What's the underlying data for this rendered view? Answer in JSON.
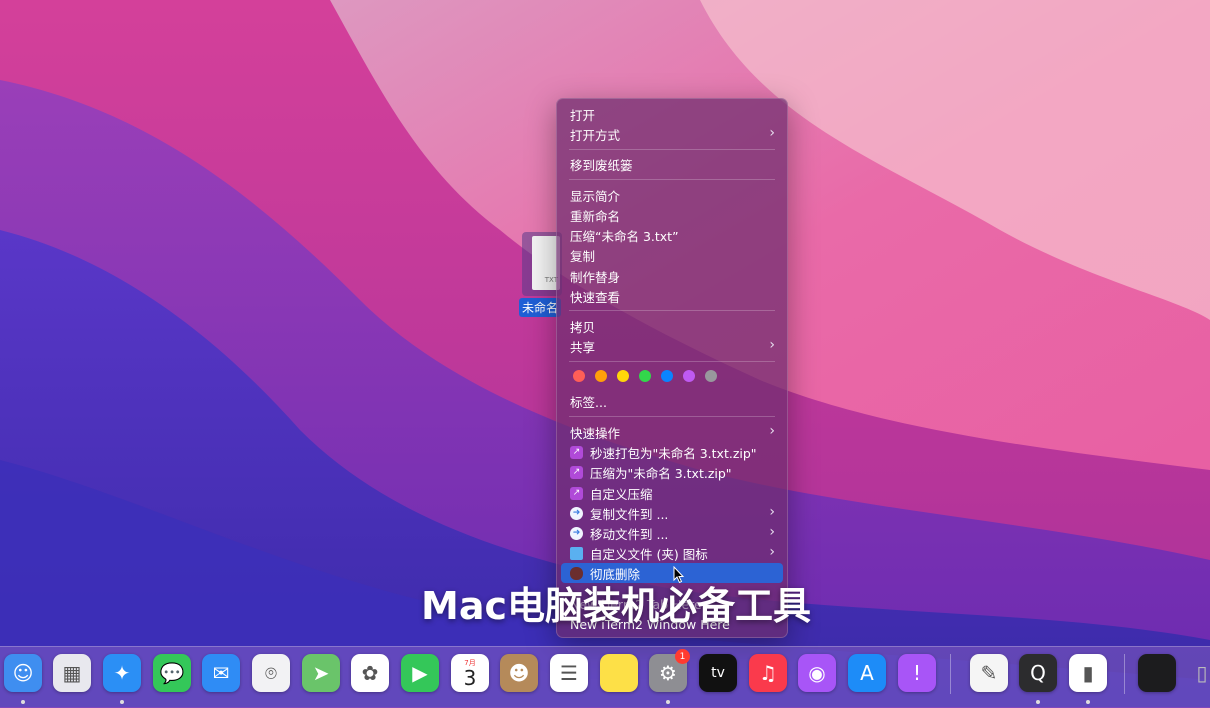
{
  "file": {
    "label": "未命名",
    "ext": "TXT"
  },
  "menu": {
    "items": [
      {
        "label": "打开"
      },
      {
        "label": "打开方式"
      },
      {
        "label": "移到废纸篓"
      },
      {
        "label": "显示简介"
      },
      {
        "label": "重新命名"
      },
      {
        "label": "压缩“未命名 3.txt”"
      },
      {
        "label": "复制"
      },
      {
        "label": "制作替身"
      },
      {
        "label": "快速查看"
      },
      {
        "label": "拷贝"
      },
      {
        "label": "共享"
      },
      {
        "label": "标签..."
      },
      {
        "label": "快速操作"
      },
      {
        "label": "秒速打包为\"未命名 3.txt.zip\""
      },
      {
        "label": "压缩为\"未命名 3.txt.zip\""
      },
      {
        "label": "自定义压缩"
      },
      {
        "label": "复制文件到 ..."
      },
      {
        "label": "移动文件到 ..."
      },
      {
        "label": "自定义文件 (夹) 图标"
      },
      {
        "label": "彻底删除"
      },
      {
        "label": "New iTerm2 Tab Here"
      },
      {
        "label": "New iTerm2 Window Here"
      }
    ],
    "tag_colors": [
      "#ff5f57",
      "#ff9f0a",
      "#ffd60a",
      "#32d74b",
      "#0a84ff",
      "#bf5af2",
      "#98989d"
    ]
  },
  "caption": "Mac电脑装机必备工具",
  "dock": {
    "calendar_month": "7月",
    "calendar_day": "3",
    "tv_label": "tv",
    "settings_badge": "1",
    "apps": [
      {
        "icon": "finder-icon",
        "color": "#3f8ef0"
      },
      {
        "icon": "launchpad-icon",
        "color": "#e8e8ee"
      },
      {
        "icon": "safari-icon",
        "color": "#2b8ff5"
      },
      {
        "icon": "messages-icon",
        "color": "#34c759"
      },
      {
        "icon": "mail-icon",
        "color": "#2f8cf5"
      },
      {
        "icon": "screenshot-icon",
        "color": "#f2f2f4"
      },
      {
        "icon": "maps-icon",
        "color": "#6ac46a"
      },
      {
        "icon": "photos-icon",
        "color": "#ffffff"
      },
      {
        "icon": "facetime-icon",
        "color": "#34c759"
      },
      {
        "icon": "calendar-icon",
        "color": "#ffffff"
      },
      {
        "icon": "contacts-icon",
        "color": "#b58a5a"
      },
      {
        "icon": "reminders-icon",
        "color": "#ffffff"
      },
      {
        "icon": "notes-icon",
        "color": "#fde047"
      },
      {
        "icon": "system-preferences-icon",
        "color": "#8e8e93"
      },
      {
        "icon": "apple-tv-icon",
        "color": "#111111"
      },
      {
        "icon": "music-icon",
        "color": "#fa3a4c"
      },
      {
        "icon": "podcasts-icon",
        "color": "#a855f7"
      },
      {
        "icon": "app-store-icon",
        "color": "#1d8cf8"
      },
      {
        "icon": "feedback-icon",
        "color": "#a855f7"
      },
      {
        "icon": "textedit-icon",
        "color": "#f5f5f5"
      },
      {
        "icon": "quicktime-icon",
        "color": "#2c2c2e"
      },
      {
        "icon": "numbers-icon",
        "color": "#ffffff"
      },
      {
        "icon": "downloads-stack-icon",
        "color": "#1c1c1e"
      },
      {
        "icon": "trash-icon",
        "color": "#9a9aa0"
      }
    ]
  }
}
